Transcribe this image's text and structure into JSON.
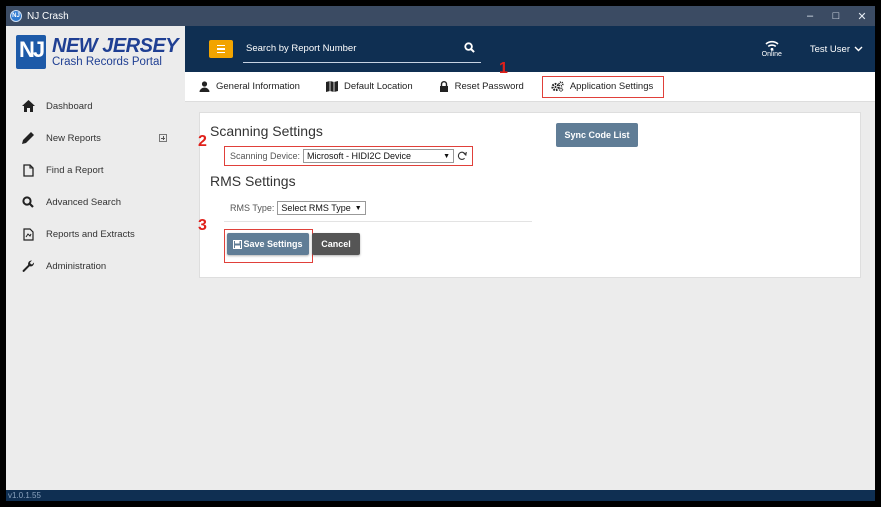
{
  "window": {
    "title": "NJ Crash",
    "logo_text": "NJ",
    "controls": {
      "minimize": "–",
      "maximize": "□",
      "close": "✕"
    }
  },
  "brand": {
    "emblem_text": "NJ",
    "title": "NEW JERSEY",
    "subtitle": "Crash Records Portal"
  },
  "sidebar": {
    "items": [
      {
        "label": "Dashboard",
        "icon": "home-icon"
      },
      {
        "label": "New Reports",
        "icon": "pencil-icon",
        "expandable": true
      },
      {
        "label": "Find a Report",
        "icon": "document-icon"
      },
      {
        "label": "Advanced Search",
        "icon": "search-icon"
      },
      {
        "label": "Reports and Extracts",
        "icon": "report-icon"
      },
      {
        "label": "Administration",
        "icon": "wrench-icon"
      }
    ]
  },
  "header": {
    "search_placeholder": "Search by Report Number",
    "status": "Online",
    "user": "Test User"
  },
  "tabs": [
    {
      "label": "General Information",
      "icon": "user-icon"
    },
    {
      "label": "Default Location",
      "icon": "map-icon"
    },
    {
      "label": "Reset Password",
      "icon": "lock-icon"
    },
    {
      "label": "Application Settings",
      "icon": "gears-icon",
      "active": true
    }
  ],
  "settings": {
    "scanning_title": "Scanning Settings",
    "scanning_device_label": "Scanning Device:",
    "scanning_device_value": "Microsoft - HIDI2C Device",
    "rms_title": "RMS Settings",
    "rms_type_label": "RMS Type:",
    "rms_type_value": "Select RMS Type",
    "save_label": "Save Settings",
    "cancel_label": "Cancel",
    "sync_label": "Sync Code List"
  },
  "annotations": {
    "step1": "1",
    "step2": "2",
    "step3": "3"
  },
  "footer": {
    "version": "v1.0.1.55"
  },
  "colors": {
    "header_bg": "#0f2f52",
    "accent_orange": "#f2a400",
    "button_blue_gray": "#607d96",
    "highlight_red": "#e0403a"
  }
}
